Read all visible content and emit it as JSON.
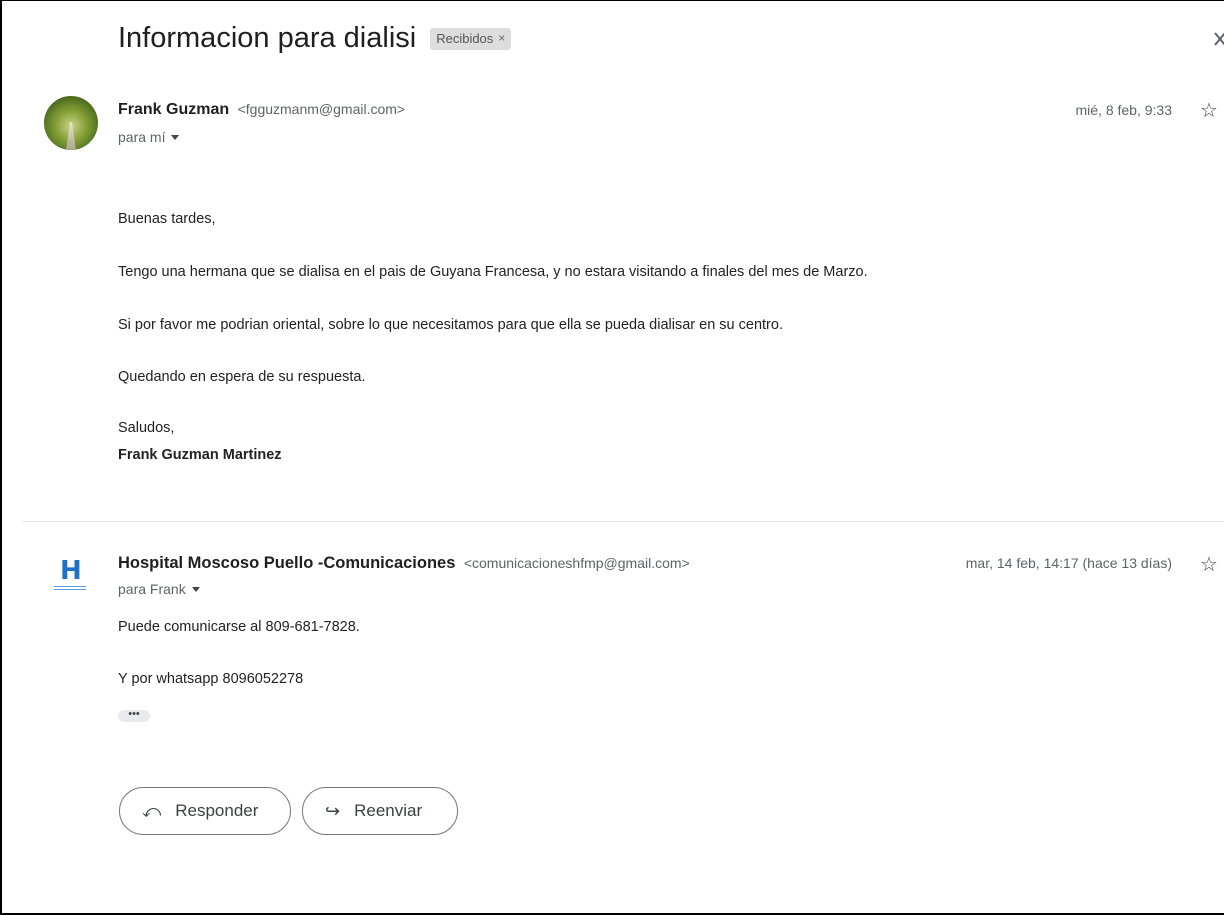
{
  "thread": {
    "subject": "Informacion para dialisi",
    "label": "Recibidos",
    "label_remove": "×",
    "close_glyph": "✕"
  },
  "messages": [
    {
      "sender_name": "Frank Guzman",
      "sender_email": "<fgguzmanm@gmail.com>",
      "to": "para mí",
      "date": "mié, 8 feb, 9:33",
      "star": "☆",
      "body": [
        "Buenas tardes,",
        "Tengo una hermana que se dialisa en el pais de Guyana Francesa, y no estara visitando a finales del mes de Marzo.",
        "Si por favor me podrian oriental, sobre lo que necesitamos para que ella se pueda dialisar en su centro.",
        "Quedando en espera de su respuesta.",
        "Saludos,"
      ],
      "signature": "Frank Guzman Martinez"
    },
    {
      "sender_name": "Hospital Moscoso Puello -Comunicaciones",
      "sender_email": "<comunicacioneshfmp@gmail.com>",
      "to": "para Frank",
      "date": "mar, 14 feb, 14:17 (hace 13 días)",
      "star": "☆",
      "avatar_letter": "H",
      "body": [
        "Puede comunicarse al 809-681-7828.",
        "Y por whatsapp 8096052278"
      ],
      "trimmed": "•••"
    }
  ],
  "actions": {
    "reply_label": "Responder",
    "reply_icon": "⤺",
    "forward_label": "Reenviar",
    "forward_icon": "↪"
  },
  "colors": {
    "label_bg": "#dddddd",
    "avatar_brand": "#1e73c8"
  }
}
